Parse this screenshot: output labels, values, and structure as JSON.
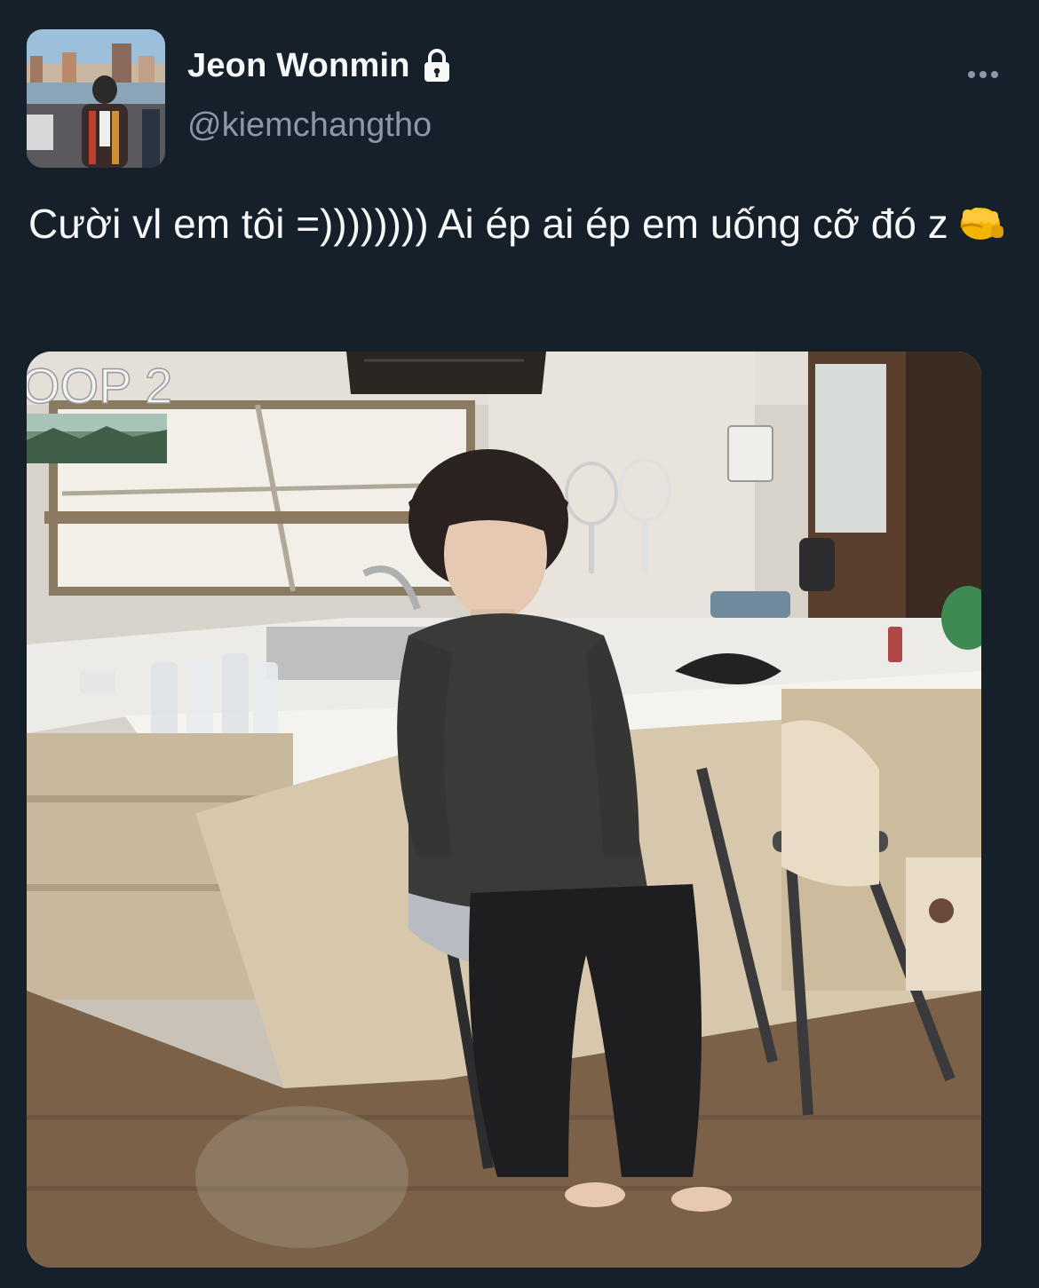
{
  "author": {
    "display_name": "Jeon Wonmin",
    "handle": "@kiemchangtho",
    "protected": true,
    "avatar_icon": "profile-photo"
  },
  "tweet": {
    "text": "Cười vl em tôi =)))))))) Ai ép ai ép em uống cỡ đó z",
    "emoji": "oncoming-fist"
  },
  "media": {
    "overlay_text": "OOP 2"
  },
  "colors": {
    "background": "#15202b",
    "primary_text": "#f7f9f9",
    "secondary_text": "#8b98a5"
  }
}
